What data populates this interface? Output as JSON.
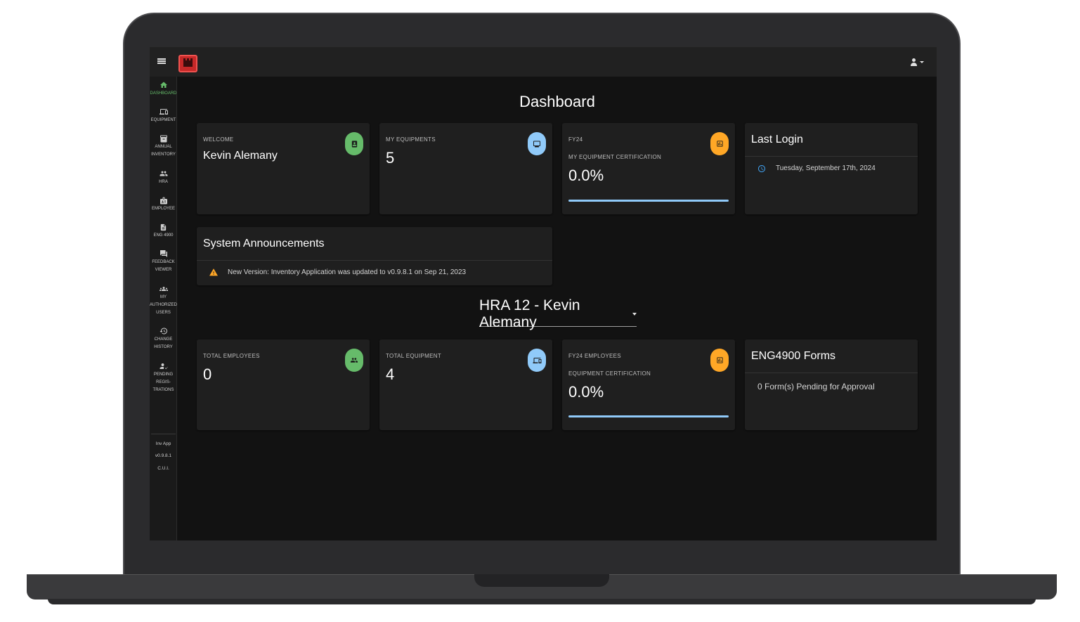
{
  "colors": {
    "accent_green": "#66bb6a",
    "accent_blue": "#90caf9",
    "accent_orange": "#ffa726",
    "warning": "#ffa726",
    "logo_red": "#c62828"
  },
  "sidebar": {
    "items": [
      {
        "label": "DASHBOARD",
        "icon": "home-icon",
        "active": true
      },
      {
        "label": "EQUIPMENT",
        "icon": "devices-icon"
      },
      {
        "label": "ANNUAL\nINVENTORY",
        "icon": "inventory-icon"
      },
      {
        "label": "HRA",
        "icon": "people-icon"
      },
      {
        "label": "EMPLOYEE",
        "icon": "badge-icon"
      },
      {
        "label": "ENG 4900",
        "icon": "document-icon"
      },
      {
        "label": "FEEDBACK\nVIEWER",
        "icon": "feedback-icon"
      },
      {
        "label": "MY\nAUTHORIZED\nUSERS",
        "icon": "group-icon"
      },
      {
        "label": "CHANGE\nHISTORY",
        "icon": "history-icon"
      },
      {
        "label": "PENDING\nREGIS-\nTRATIONS",
        "icon": "person-check-icon"
      }
    ],
    "footer": [
      "Inv App",
      "v0.9.8.1",
      "C.U.I."
    ]
  },
  "main": {
    "title": "Dashboard",
    "welcome": {
      "label": "WELCOME",
      "value": "Kevin Alemany",
      "icon": "contact-icon"
    },
    "my_equipments": {
      "label": "MY EQUIPMENTS",
      "value": "5",
      "icon": "monitor-icon"
    },
    "certification": {
      "label": "FY24",
      "sublabel": "MY EQUIPMENT CERTIFICATION",
      "value": "0.0%",
      "icon": "chart-icon",
      "progress": 0.0
    },
    "last_login": {
      "title": "Last Login",
      "value": "Tuesday, September 17th, 2024",
      "icon": "clock-icon"
    },
    "announcements": {
      "title": "System Announcements",
      "message": "New Version: Inventory Application was updated to v0.9.8.1 on Sep 21, 2023",
      "icon": "warning-icon"
    },
    "hra_select": {
      "value": "HRA 12 - Kevin Alemany"
    },
    "total_employees": {
      "label": "TOTAL EMPLOYEES",
      "value": "0",
      "icon": "people-icon"
    },
    "total_equipment": {
      "label": "TOTAL EQUIPMENT",
      "value": "4",
      "icon": "devices-icon"
    },
    "emp_certification": {
      "label": "FY24 EMPLOYEES",
      "sublabel": "EQUIPMENT CERTIFICATION",
      "value": "0.0%",
      "icon": "chart-icon",
      "progress": 0.0
    },
    "eng4900": {
      "title": "ENG4900 Forms",
      "message": "0 Form(s) Pending for Approval"
    }
  }
}
